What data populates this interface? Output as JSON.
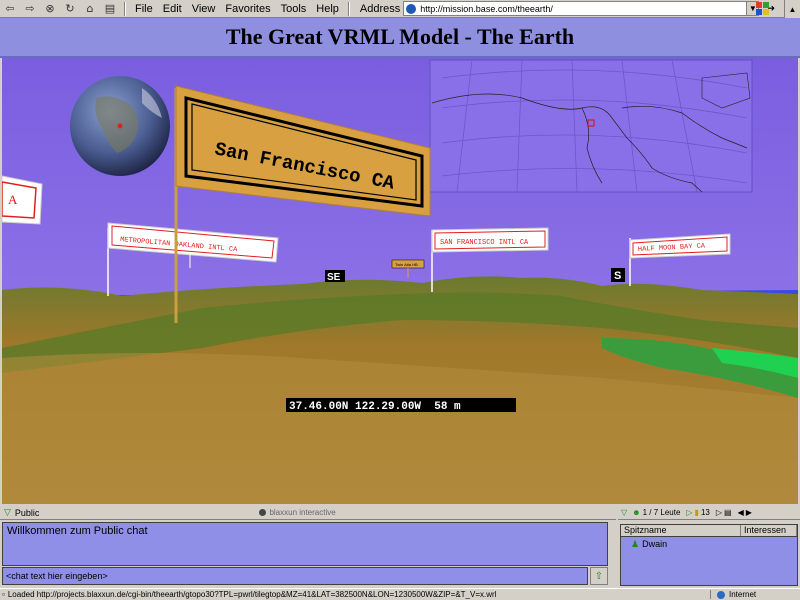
{
  "toolbar": {
    "menus": [
      "File",
      "Edit",
      "View",
      "Favorites",
      "Tools",
      "Help"
    ],
    "address_label": "Address",
    "address_value": "http://mission.base.com/theearth/"
  },
  "page": {
    "title": "The Great VRML Model - The Earth"
  },
  "scene": {
    "main_flag": "San Francisco CA",
    "left_partial_flag": "A",
    "flags": [
      "METROPOLITAN OAKLAND INTL CA",
      "SAN FRANCISCO INTL CA",
      "HALF MOON BAY CA",
      "Twin Atla HB"
    ],
    "compass_se": "SE",
    "compass_s": "S",
    "coordinates": "37.46.00N 122.29.00W  58 m"
  },
  "chat": {
    "tab_label": "Public",
    "brand": "blaxxun interactive",
    "welcome": "Willkommen zum Public chat",
    "input_placeholder": "<chat text hier eingeben>"
  },
  "users": {
    "count_label": "1 / 7 Leute",
    "number": "13",
    "col_name": "Spitzname",
    "col_interests": "Interessen",
    "list": [
      "Dwain"
    ]
  },
  "status": {
    "loaded": "Loaded http://projects.blaxxun.de/cgi-bin/theearth/gtopo30?TPL=pwrl/tilegtop&MZ=41&LAT=382500N&LON=1230500W&ZIP=&T_V=x.wrl",
    "zone": "Internet"
  }
}
